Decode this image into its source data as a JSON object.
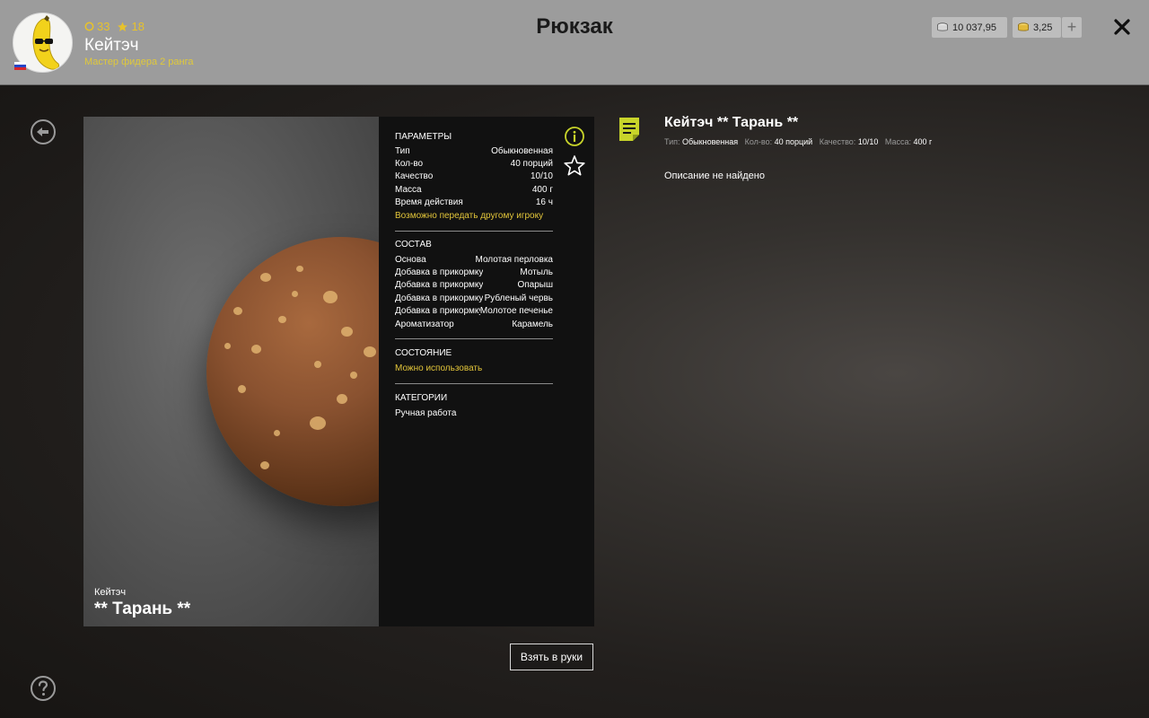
{
  "header": {
    "title": "Рюкзак",
    "player": {
      "name": "Кейтэч",
      "rank": "Мастер фидера 2 ранга",
      "level": "33",
      "stars": "18"
    },
    "money": {
      "silver": "10 037,95",
      "gold": "3,25",
      "add_label": "+"
    }
  },
  "preview": {
    "subtitle": "Кейтэч",
    "name": "** Тарань **"
  },
  "params": {
    "section_params": "ПАРАМЕТРЫ",
    "rows": [
      {
        "label": "Тип",
        "value": "Обыкновенная"
      },
      {
        "label": "Кол-во",
        "value": "40 порций"
      },
      {
        "label": "Качество",
        "value": "10/10"
      },
      {
        "label": "Масса",
        "value": "400 г"
      },
      {
        "label": "Время действия",
        "value": "16 ч"
      }
    ],
    "transfer_note": "Возможно передать другому игроку",
    "section_composition": "СОСТАВ",
    "composition": [
      {
        "label": "Основа",
        "value": "Молотая перловка"
      },
      {
        "label": "Добавка в прикормку",
        "value": "Мотыль"
      },
      {
        "label": "Добавка в прикормку",
        "value": "Опарыш"
      },
      {
        "label": "Добавка в прикормку",
        "value": "Рубленый червь"
      },
      {
        "label": "Добавка в прикормку",
        "value": "Молотое печенье"
      },
      {
        "label": "Ароматизатор",
        "value": "Карамель"
      }
    ],
    "section_state": "СОСТОЯНИЕ",
    "state": "Можно использовать",
    "section_categories": "КАТЕГОРИИ",
    "category": "Ручная работа"
  },
  "details": {
    "title": "Кейтэч ** Тарань **",
    "meta": [
      {
        "label": "Тип:",
        "value": "Обыкновенная"
      },
      {
        "label": "Кол-во:",
        "value": "40 порций"
      },
      {
        "label": "Качество:",
        "value": "10/10"
      },
      {
        "label": "Масса:",
        "value": "400 г"
      }
    ],
    "description": "Описание не найдено"
  },
  "actions": {
    "take_label": "Взять в руки"
  },
  "colors": {
    "accent_yellow": "#e2c53a",
    "header_bg": "#9c9c9c",
    "panel_bg": "#111111",
    "note_icon": "#c8d42a"
  }
}
